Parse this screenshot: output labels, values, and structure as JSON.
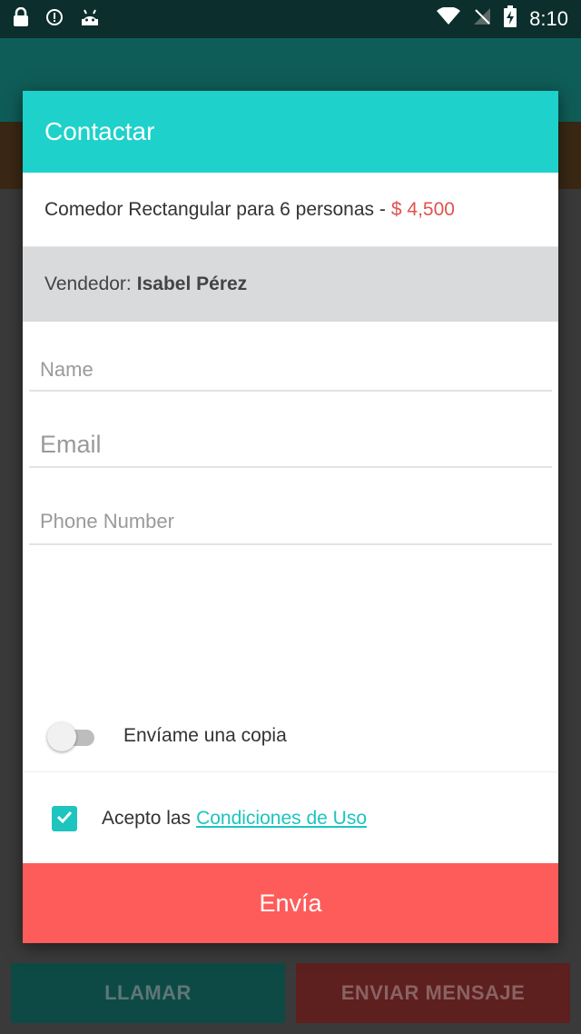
{
  "status_bar": {
    "time": "8:10",
    "icons": [
      "lock-icon",
      "alert-circle-icon",
      "android-icon",
      "wifi-icon",
      "no-signal-icon",
      "battery-charging-icon"
    ]
  },
  "background": {
    "call_label": "LLAMAR",
    "message_label": "ENVIAR MENSAJE"
  },
  "dialog": {
    "title": "Contactar",
    "product": "Comedor Rectangular para 6 personas -",
    "price": "$ 4,500",
    "seller_label": "Vendedor:",
    "seller_name": "Isabel Pérez",
    "fields": {
      "name_placeholder": "Name",
      "email_placeholder": "Email",
      "phone_placeholder": "Phone Number"
    },
    "copy_label": "Envíame una copia",
    "copy_enabled": false,
    "terms_prefix": "Acepto las",
    "terms_link": "Condiciones de Uso",
    "terms_checked": true,
    "send_label": "Envía"
  },
  "colors": {
    "accent": "#1ed1cb",
    "price": "#e0534f",
    "send_button": "#fe5c5a"
  }
}
